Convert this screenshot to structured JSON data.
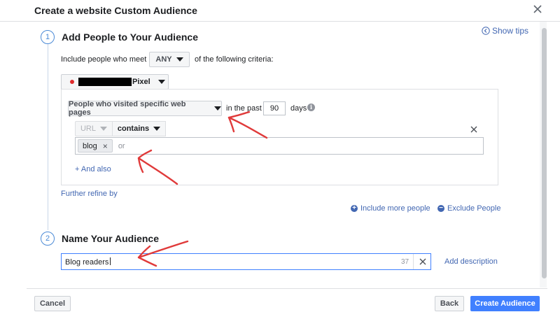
{
  "dialog": {
    "title": "Create a website Custom Audience",
    "show_tips": "Show tips"
  },
  "section1": {
    "number": "1",
    "title": "Add People to Your Audience",
    "include_prefix": "Include people who meet",
    "match_value": "ANY",
    "include_suffix": "of the following criteria:",
    "pixel_label": "Pixel",
    "rule": {
      "event_label": "People who visited specific web pages",
      "in_the_past": "in the past",
      "days_value": "90",
      "days_label": "days",
      "info_icon_glyph": "i",
      "field_label": "URL",
      "operator_label": "contains",
      "tokens": [
        {
          "label": "blog"
        }
      ],
      "token_placeholder": "or",
      "and_also": "+ And also"
    },
    "further_refine": "Further refine by",
    "include_more": "Include more people",
    "exclude": "Exclude People"
  },
  "section2": {
    "number": "2",
    "title": "Name Your Audience",
    "name_value": "Blog readers",
    "char_count": "37",
    "add_description": "Add description"
  },
  "footer": {
    "cancel": "Cancel",
    "back": "Back",
    "create": "Create Audience"
  },
  "colors": {
    "accent": "#4267b2",
    "primary_button": "#4080ff",
    "annotation_red": "#e03a3a",
    "pixel_status": "#e02c2c"
  }
}
